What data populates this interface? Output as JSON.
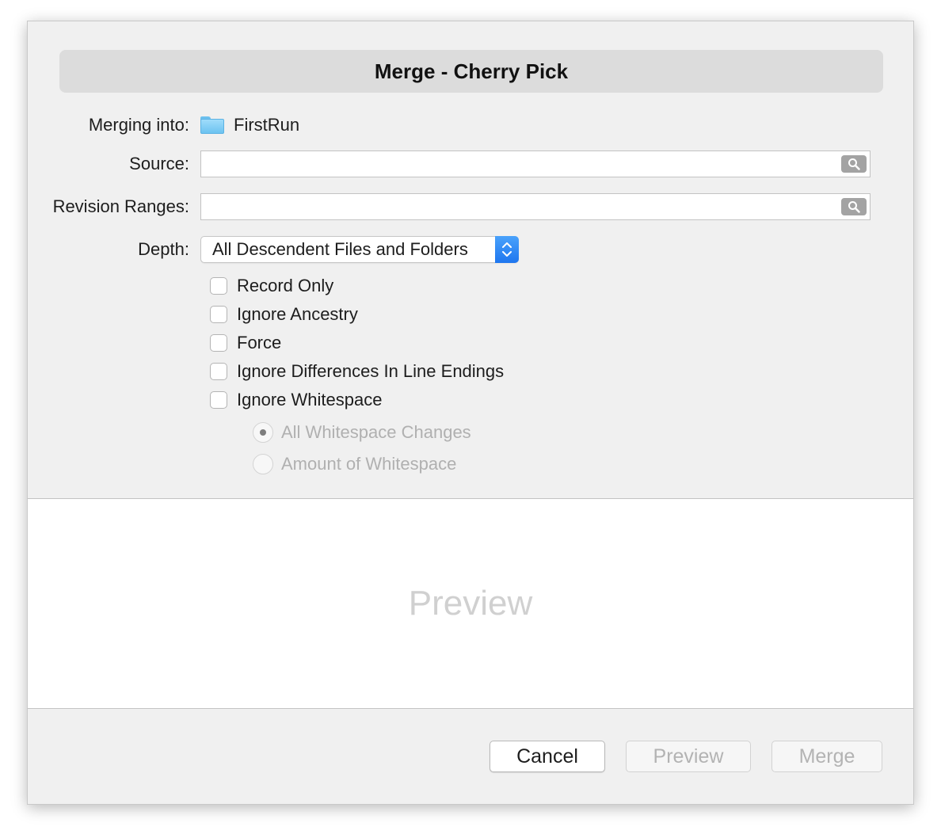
{
  "dialog": {
    "title": "Merge - Cherry Pick"
  },
  "form": {
    "merging_into_label": "Merging into:",
    "merging_into_value": "FirstRun",
    "source_label": "Source:",
    "source_value": "",
    "revision_ranges_label": "Revision Ranges:",
    "revision_ranges_value": "",
    "depth_label": "Depth:",
    "depth_selected": "All Descendent Files and Folders"
  },
  "options": [
    {
      "label": "Record Only",
      "checked": false
    },
    {
      "label": "Ignore Ancestry",
      "checked": false
    },
    {
      "label": "Force",
      "checked": false
    },
    {
      "label": "Ignore Differences In Line Endings",
      "checked": false
    },
    {
      "label": "Ignore Whitespace",
      "checked": false
    }
  ],
  "whitespace_modes": [
    {
      "label": "All Whitespace Changes",
      "selected": true,
      "enabled": false
    },
    {
      "label": "Amount of Whitespace",
      "selected": false,
      "enabled": false
    }
  ],
  "preview": {
    "placeholder": "Preview"
  },
  "buttons": {
    "cancel": "Cancel",
    "preview": "Preview",
    "merge": "Merge"
  },
  "icons": {
    "folder": "folder-icon",
    "search": "search-icon",
    "stepper": "chevron-up-down-icon"
  },
  "colors": {
    "accent": "#1e76ef",
    "folder": "#6cc3f0"
  }
}
